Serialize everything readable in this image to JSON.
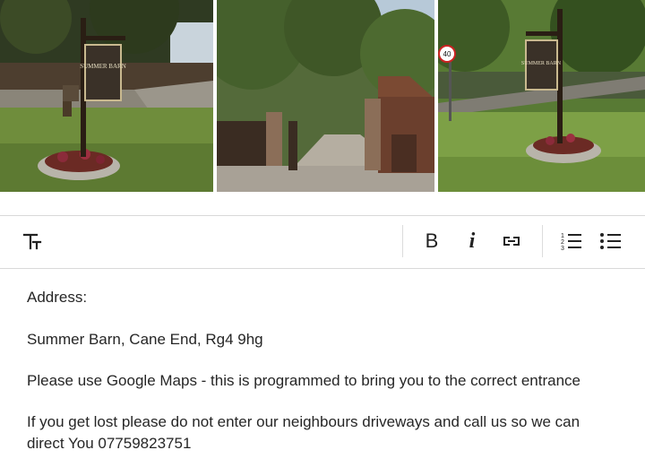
{
  "photos": [
    {
      "sign_text": "SUMMER BARN"
    },
    {},
    {
      "sign_text": "SUMMER BARN",
      "speed_sign": "40"
    }
  ],
  "toolbar": {
    "text_style_icon": "text-size-icon",
    "bold_label": "B",
    "italic_label": "i",
    "link_icon": "link-icon",
    "ordered_list_icon": "ordered-list-icon",
    "bullet_list_icon": "bullet-list-icon"
  },
  "editor": {
    "heading": "Address:",
    "address": "Summer Barn, Cane End, Rg4 9hg",
    "maps_note": "Please use Google Maps - this is programmed to bring you to the correct entrance",
    "lost_note": "If you get lost please do not enter our neighbours driveways and call us so we can direct You 07759823751"
  }
}
